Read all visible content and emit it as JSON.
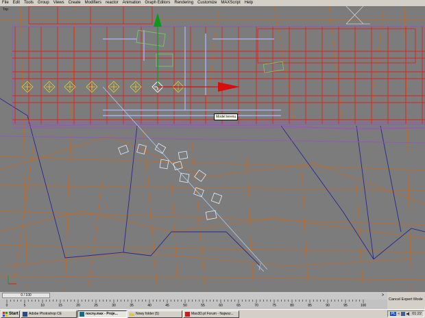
{
  "menu": {
    "items": [
      "File",
      "Edit",
      "Tools",
      "Group",
      "Views",
      "Create",
      "Modifiers",
      "reactor",
      "Animation",
      "Graph Editors",
      "Rendering",
      "Customize",
      "MAXScript",
      "Help"
    ]
  },
  "viewport": {
    "label": "Top",
    "tooltip": "Model terenu"
  },
  "timeslider": {
    "frame_label": "0 / 100",
    "next_glyph": ">"
  },
  "trackbar": {
    "ticks": [
      "0",
      "5",
      "10",
      "15",
      "20",
      "25",
      "30",
      "35",
      "40",
      "45",
      "50",
      "55",
      "60",
      "65",
      "70",
      "75",
      "80",
      "85",
      "90",
      "95",
      "100"
    ]
  },
  "status": {
    "cancel_expert_mode": "Cancel Expert Mode"
  },
  "taskbar": {
    "start": "Start",
    "buttons": [
      {
        "label": "Adobe Photoshop CE",
        "icon": "photoshop-icon",
        "active": false
      },
      {
        "label": "nocny.max - Proje...",
        "icon": "3dsmax-icon",
        "active": true
      },
      {
        "label": "Nowy folder (5)",
        "icon": "folder-icon",
        "active": false
      },
      {
        "label": "Max3D.pl Forum - Najwsz...",
        "icon": "browser-icon",
        "active": false
      }
    ],
    "tray": {
      "lang": "PL",
      "clock": "01:22"
    }
  },
  "colors": {
    "viewport_bg": "#7c7c7c",
    "grid_red": "#e0201c",
    "terrain_orange": "#c86a1e",
    "terrain_blue": "#27268e",
    "wire_purple": "#9a50c8",
    "gizmo_green": "#0a9a1a",
    "gizmo_red": "#d80d0d"
  }
}
